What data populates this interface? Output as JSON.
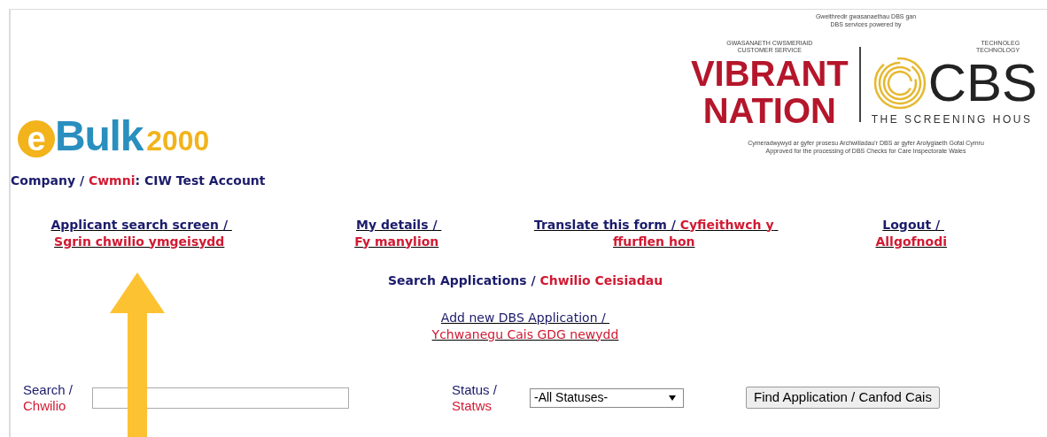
{
  "header": {
    "logo": {
      "mark": "e",
      "name": "Bulk",
      "suffix": "2000"
    },
    "partner_logo": {
      "caption": [
        "Gweithredir gwasanaethau DBS gan",
        "DBS services powered by"
      ],
      "left_label": [
        "GWASANAETH CWSMERIAID",
        "CUSTOMER SERVICE"
      ],
      "left_name": [
        "VIBRANT",
        "NATION"
      ],
      "right_label": [
        "TECHNOLEG",
        "TECHNOLOGY"
      ],
      "right_name": "CBS",
      "right_tagline": "THE SCREENING HOUS",
      "footer": [
        "Cymeradwywyd ar gyfer prosesu Archwiliadau'r DBS ar gyfer Arolygiaeth Gofal Cymru",
        "Approved for the processing of DBS Checks for Care Inspectorate Wales"
      ]
    }
  },
  "company": [
    {
      "kind": "english",
      "text": "Company / "
    },
    {
      "kind": "welsh",
      "text": "Cwmni"
    },
    {
      "kind": "english",
      "text": ": CIW Test Account"
    }
  ],
  "nav_links": [
    [
      {
        "kind": "english",
        "text": "Applicant search screen / "
      },
      {
        "kind": "welsh",
        "text": "Sgrin chwilio ymgeisydd"
      }
    ],
    [
      {
        "kind": "english",
        "text": "My details / "
      },
      {
        "kind": "welsh",
        "text": "Fy manylion"
      }
    ],
    [
      {
        "kind": "english",
        "text": "Translate this form / "
      },
      {
        "kind": "welsh",
        "text": "Cyfieithwch y ffurflen hon"
      }
    ],
    [
      {
        "kind": "english",
        "text": "Logout / "
      },
      {
        "kind": "welsh",
        "text": "Allgofnodi"
      }
    ]
  ],
  "section_title": [
    {
      "kind": "english",
      "text": "Search Applications / "
    },
    {
      "kind": "welsh",
      "text": "Chwilio Ceisiadau"
    }
  ],
  "add_link": [
    {
      "kind": "english",
      "text": "Add new DBS Application / "
    },
    {
      "kind": "welsh",
      "text": "Ychwanegu Cais GDG newydd"
    }
  ],
  "search": {
    "label": [
      {
        "kind": "english",
        "text": "Search / "
      },
      {
        "kind": "welsh",
        "text": "Chwilio"
      }
    ]
  },
  "status": {
    "label": [
      {
        "kind": "english",
        "text": "Status / "
      },
      {
        "kind": "welsh",
        "text": "Statws"
      }
    ],
    "value": "-All Statuses-"
  },
  "find_button": "Find Application / Canfod Cais"
}
